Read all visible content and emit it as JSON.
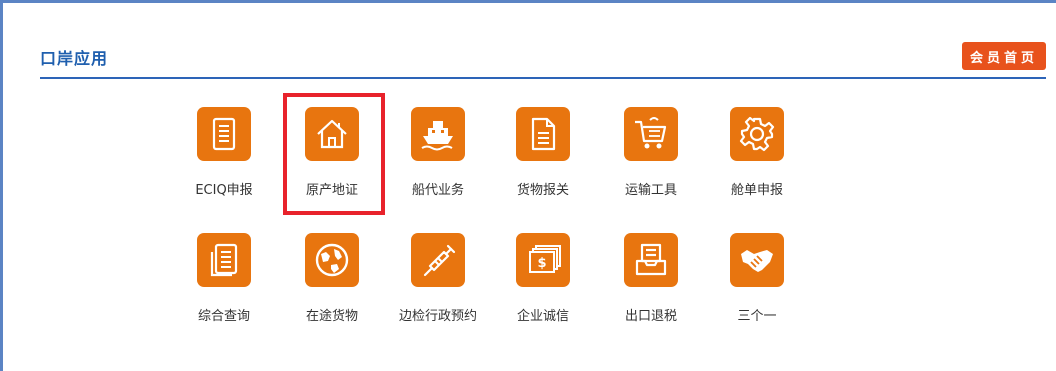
{
  "header": {
    "title": "口岸应用",
    "home_button_label": "会员首页"
  },
  "apps": [
    {
      "label": "ECIQ申报",
      "icon": "document-icon"
    },
    {
      "label": "原产地证",
      "icon": "house-icon"
    },
    {
      "label": "船代业务",
      "icon": "ship-icon"
    },
    {
      "label": "货物报关",
      "icon": "file-icon"
    },
    {
      "label": "运输工具",
      "icon": "cart-icon"
    },
    {
      "label": "舱单申报",
      "icon": "gear-icon"
    },
    {
      "label": "综合查询",
      "icon": "clipboard-list-icon"
    },
    {
      "label": "在途货物",
      "icon": "globe-icon"
    },
    {
      "label": "边检行政预约",
      "icon": "syringe-icon"
    },
    {
      "label": "企业诚信",
      "icon": "money-stack-icon"
    },
    {
      "label": "出口退税",
      "icon": "inbox-tray-icon"
    },
    {
      "label": "三个一",
      "icon": "handshake-icon"
    }
  ],
  "colors": {
    "accent": "#e8750f",
    "header_blue": "#1f5fae",
    "home_button": "#e8521c",
    "highlight": "#e8222b"
  }
}
